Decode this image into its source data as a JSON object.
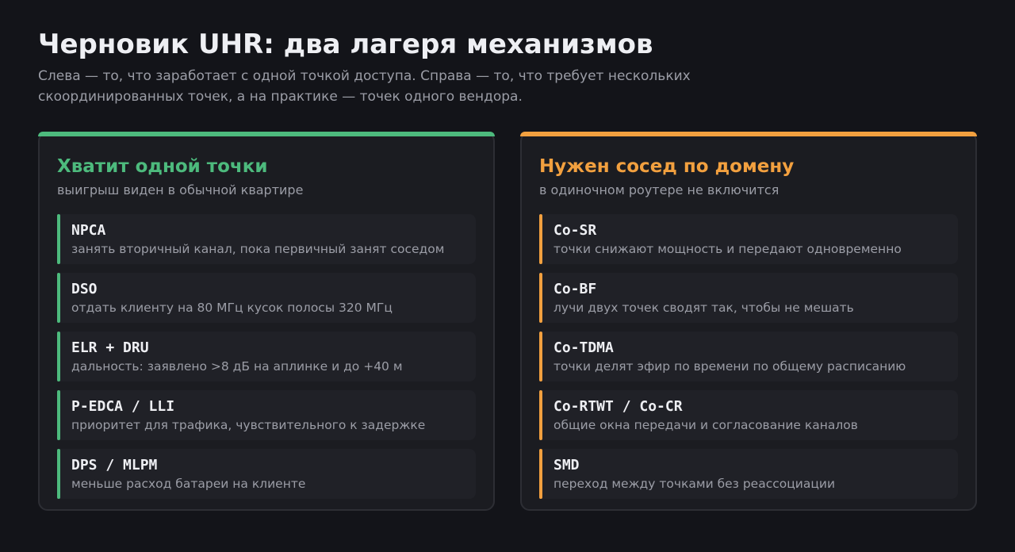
{
  "header": {
    "title": "Черновик UHR: два лагеря механизмов",
    "subtitle": "Слева — то, что заработает с одной точкой доступа. Справа — то, что требует нескольких скоординированных точек, а на практике — точек одного вендора."
  },
  "colors": {
    "background": "#131419",
    "left_accent": "#4dba7d",
    "right_accent": "#f2a03f"
  },
  "left": {
    "title": "Хватит одной точки",
    "subtitle": "выигрыш виден в обычной квартире",
    "items": [
      {
        "name": "NPCA",
        "desc": "занять вторичный канал, пока первичный занят соседом"
      },
      {
        "name": "DSO",
        "desc": "отдать клиенту на 80 МГц кусок полосы 320 МГц"
      },
      {
        "name": "ELR + DRU",
        "desc": "дальность: заявлено >8 дБ на аплинке и до +40 м"
      },
      {
        "name": "P-EDCA / LLI",
        "desc": "приоритет для трафика, чувствительного к задержке"
      },
      {
        "name": "DPS / MLPM",
        "desc": "меньше расход батареи на клиенте"
      }
    ]
  },
  "right": {
    "title": "Нужен сосед по домену",
    "subtitle": "в одиночном роутере не включится",
    "items": [
      {
        "name": "Co-SR",
        "desc": "точки снижают мощность и передают одновременно"
      },
      {
        "name": "Co-BF",
        "desc": "лучи двух точек сводят так, чтобы не мешать"
      },
      {
        "name": "Co-TDMA",
        "desc": "точки делят эфир по времени по общему расписанию"
      },
      {
        "name": "Co-RTWT / Co-CR",
        "desc": "общие окна передачи и согласование каналов"
      },
      {
        "name": "SMD",
        "desc": "переход между точками без реассоциации"
      }
    ]
  }
}
